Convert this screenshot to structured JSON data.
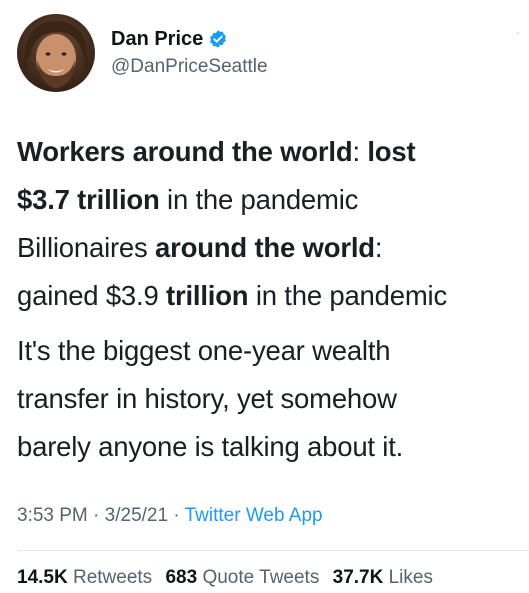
{
  "user": {
    "name": "Dan Price",
    "handle": "@DanPriceSeattle",
    "verified_icon": "verified-badge-icon",
    "avatar_icon": "avatar-photo"
  },
  "tweet": {
    "lines": [
      [
        {
          "t": "Workers around the world",
          "b": true
        },
        {
          "t": ": ",
          "b": false
        },
        {
          "t": "lost",
          "b": true
        }
      ],
      [
        {
          "t": "$3.7 trillion",
          "b": true
        },
        {
          "t": " in the pandemic",
          "b": false
        }
      ],
      [
        {
          "t": "Billionaires ",
          "b": false
        },
        {
          "t": "around the world",
          "b": true
        },
        {
          "t": ":",
          "b": false
        }
      ],
      [
        {
          "t": "gained $3.9 ",
          "b": false
        },
        {
          "t": "trillion",
          "b": true
        },
        {
          "t": " in the pandemic",
          "b": false
        }
      ]
    ],
    "paragraph2": [
      "It's the biggest one-year wealth",
      "transfer in history, yet somehow",
      "barely anyone is talking about it."
    ]
  },
  "meta": {
    "time": "3:53 PM",
    "date": "3/25/21",
    "separator": " · ",
    "source": "Twitter Web App"
  },
  "stats": {
    "retweets_count": "14.5K",
    "retweets_label": "Retweets",
    "quotes_count": "683",
    "quotes_label": "Quote Tweets",
    "likes_count": "37.7K",
    "likes_label": "Likes"
  },
  "colors": {
    "accent": "#1d9bf0",
    "secondary_text": "#536471",
    "primary_text": "#0f1419"
  }
}
